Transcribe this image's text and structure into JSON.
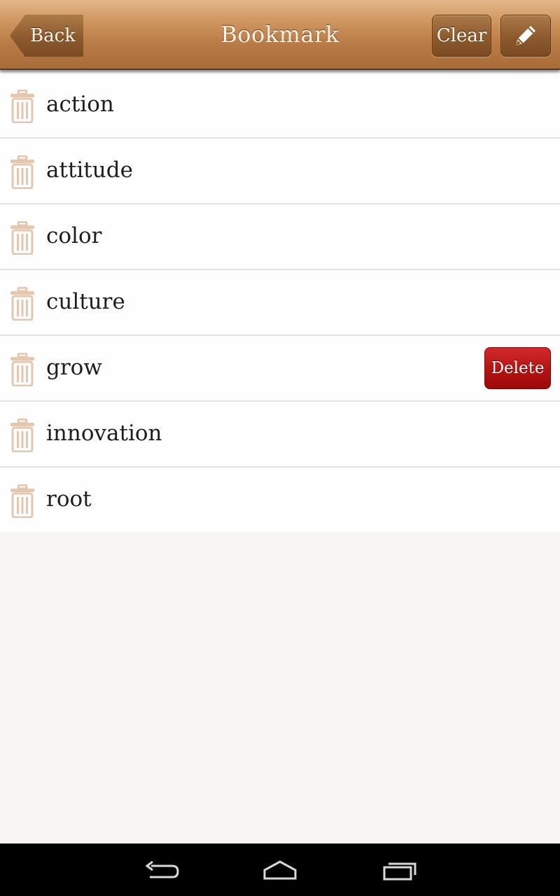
{
  "header": {
    "title": "Bookmark",
    "back_label": "Back",
    "clear_label": "Clear",
    "edit_icon": "pencil-icon"
  },
  "bookmarks": [
    {
      "word": "action"
    },
    {
      "word": "attitude"
    },
    {
      "word": "color"
    },
    {
      "word": "culture"
    },
    {
      "word": "grow",
      "delete_label": "Delete"
    },
    {
      "word": "innovation"
    },
    {
      "word": "root"
    }
  ],
  "colors": {
    "header_brown": "#b87a45",
    "button_brown": "#8d5a2e",
    "delete_red": "#b51212",
    "trash_tan": "#e3c7b0"
  },
  "navbar": {
    "icons": [
      "back-icon",
      "home-icon",
      "recent-apps-icon"
    ]
  }
}
